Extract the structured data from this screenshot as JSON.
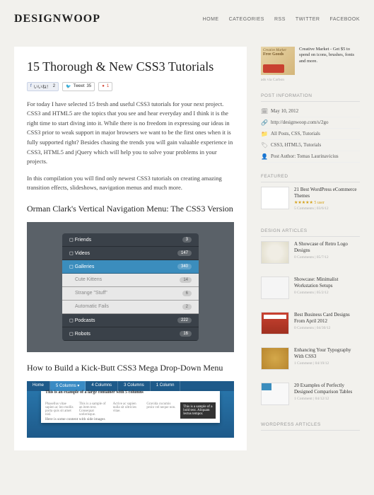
{
  "site": {
    "logo": "DESIGNWOOP"
  },
  "nav": [
    "HOME",
    "CATEGORIES",
    "RSS",
    "TWITTER",
    "FACEBOOK"
  ],
  "article": {
    "title": "15 Thorough & New CSS3 Tutorials",
    "social": {
      "fb": "いいね！",
      "fb_count": "2",
      "tweet": "Tweet",
      "tweet_count": "35",
      "gplus": "1"
    },
    "p1": "For today I have selected 15 fresh and useful  CSS3 tutorials  for your next project. CSS3 and HTML5 are the topics that you see and hear everyday and I think it is the right time to start diving into it. While there is no freedom in expressing our ideas in CSS3 prior to weak support in major browsers we want to be the first ones when it is fully supported right? Besides chasing the trends you will gain valuable experience in CSS3, HTML5 and jQuery which will help you to solve your problems in your projects.",
    "p2": "In this compilation you will find only newest CSS3 tutorials on creating amazing transition effects, slideshows, navigation menus and much more.",
    "h2a": "Orman Clark's Vertical Navigation Menu: The CSS3 Version",
    "h2b": "How to Build a Kick-Butt CSS3 Mega Drop-Down Menu",
    "menu": [
      {
        "label": "Friends",
        "badge": "3",
        "type": "main"
      },
      {
        "label": "Videos",
        "badge": "147",
        "type": "main"
      },
      {
        "label": "Galleries",
        "badge": "340",
        "type": "active"
      },
      {
        "label": "Cute Kittens",
        "badge": "14",
        "type": "sub"
      },
      {
        "label": "Strange \"Stuff\"",
        "badge": "6",
        "type": "sub"
      },
      {
        "label": "Automatic Fails",
        "badge": "2",
        "type": "sub"
      },
      {
        "label": "Podcasts",
        "badge": "222",
        "type": "main"
      },
      {
        "label": "Robots",
        "badge": "16",
        "type": "main"
      }
    ],
    "dropdown": {
      "header": "This is an example of a large container with 5 columns",
      "footer": "Here is some content with side images",
      "tabs": [
        "Home",
        "5 Columns ▾",
        "4 Columns",
        "3 Columns",
        "1 Column"
      ]
    }
  },
  "sidebar": {
    "ad": {
      "img_text": "Creative Market",
      "img_sub": "Free Goods",
      "text": "Creative Market - Get $5 to spend on icons, brushes, fonts and more.",
      "via": "ads via Carbon"
    },
    "post_info": {
      "title": "POST INFORMATION",
      "items": [
        {
          "icon": "date",
          "text": "May 10, 2012"
        },
        {
          "icon": "link",
          "text": "http://designwoop.com/s/2go"
        },
        {
          "icon": "folder",
          "text": "All Posts, CSS, Tutorials"
        },
        {
          "icon": "tag",
          "text": "CSS3, HTML5, Tutorials"
        },
        {
          "icon": "user",
          "text": "Post Author: Tomas Laurinavicius"
        }
      ]
    },
    "featured": {
      "title": "FEATURED",
      "item": {
        "title": "21 Best WordPress eCommerce Themes",
        "stars": "5 user",
        "meta": "5 Comments | 03/6/12"
      }
    },
    "design": {
      "title": "DESIGN ARTICLES",
      "items": [
        {
          "title": "A Showcase of Retro Logo Designs",
          "meta": "0 Comments | 05/7/12",
          "thumb": "tb2"
        },
        {
          "title": "Showcase: Minimalist Workstation Setups",
          "meta": "0 Comments | 05/2/12",
          "thumb": "tb3"
        },
        {
          "title": "Best Business Card Designs From April 2012",
          "meta": "0 Comments | 04/30/12",
          "thumb": "tb4"
        },
        {
          "title": "Enhancing Your Typography With CSS3",
          "meta": "1 Comment | 04/19/12",
          "thumb": "tb5"
        },
        {
          "title": "20 Examples of Perfectly Designed Comparison Tables",
          "meta": "1 Comment | 04/12/12",
          "thumb": "tb6"
        }
      ]
    },
    "wp": {
      "title": "WORDPRESS ARTICLES"
    }
  }
}
